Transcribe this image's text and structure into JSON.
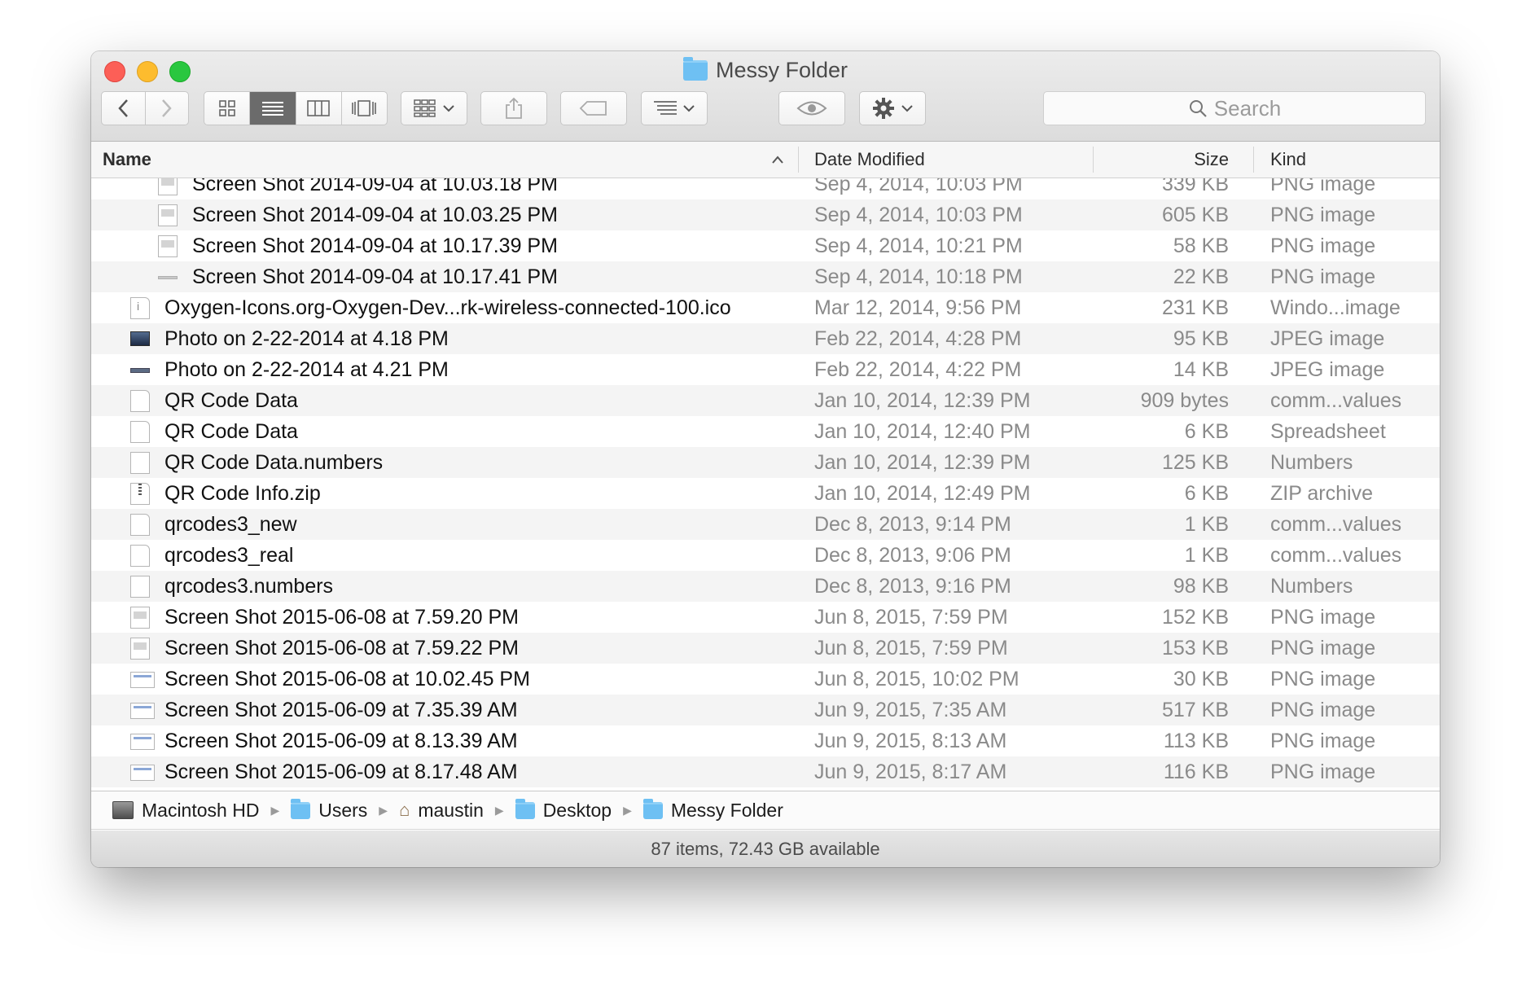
{
  "window": {
    "title": "Messy Folder"
  },
  "toolbar": {
    "back_icon": "chevron-left-icon",
    "forward_icon": "chevron-right-icon",
    "search_placeholder": "Search"
  },
  "columns": {
    "name": "Name",
    "date": "Date Modified",
    "size": "Size",
    "kind": "Kind"
  },
  "rows": [
    {
      "name": "Screen Shot 2014-09-04 at 10.03.18 PM",
      "date": "Sep 4, 2014, 10:03 PM",
      "size": "339 KB",
      "kind": "PNG image",
      "indent": true,
      "icon": "image-file-icon"
    },
    {
      "name": "Screen Shot 2014-09-04 at 10.03.25 PM",
      "date": "Sep 4, 2014, 10:03 PM",
      "size": "605 KB",
      "kind": "PNG image",
      "indent": true,
      "icon": "image-file-icon"
    },
    {
      "name": "Screen Shot 2014-09-04 at 10.17.39 PM",
      "date": "Sep 4, 2014, 10:21 PM",
      "size": "58 KB",
      "kind": "PNG image",
      "indent": true,
      "icon": "image-file-icon"
    },
    {
      "name": "Screen Shot 2014-09-04 at 10.17.41 PM",
      "date": "Sep 4, 2014, 10:18 PM",
      "size": "22 KB",
      "kind": "PNG image",
      "indent": true,
      "icon": "image-strip-icon"
    },
    {
      "name": "Oxygen-Icons.org-Oxygen-Dev...rk-wireless-connected-100.ico",
      "date": "Mar 12, 2014, 9:56 PM",
      "size": "231 KB",
      "kind": "Windo...image",
      "indent": false,
      "icon": "ico-file-icon"
    },
    {
      "name": "Photo on 2-22-2014 at 4.18 PM",
      "date": "Feb 22, 2014, 4:28 PM",
      "size": "95 KB",
      "kind": "JPEG image",
      "indent": false,
      "icon": "photo-icon"
    },
    {
      "name": "Photo on 2-22-2014 at 4.21 PM",
      "date": "Feb 22, 2014, 4:22 PM",
      "size": "14 KB",
      "kind": "JPEG image",
      "indent": false,
      "icon": "photo-strip-icon"
    },
    {
      "name": "QR Code Data",
      "date": "Jan 10, 2014, 12:39 PM",
      "size": "909 bytes",
      "kind": "comm...values",
      "indent": false,
      "icon": "document-icon"
    },
    {
      "name": "QR Code Data",
      "date": "Jan 10, 2014, 12:40 PM",
      "size": "6 KB",
      "kind": "Spreadsheet",
      "indent": false,
      "icon": "document-icon"
    },
    {
      "name": "QR Code Data.numbers",
      "date": "Jan 10, 2014, 12:39 PM",
      "size": "125 KB",
      "kind": "Numbers",
      "indent": false,
      "icon": "numbers-file-icon"
    },
    {
      "name": "QR Code Info.zip",
      "date": "Jan 10, 2014, 12:49 PM",
      "size": "6 KB",
      "kind": "ZIP archive",
      "indent": false,
      "icon": "zip-file-icon"
    },
    {
      "name": "qrcodes3_new",
      "date": "Dec 8, 2013, 9:14 PM",
      "size": "1 KB",
      "kind": "comm...values",
      "indent": false,
      "icon": "document-icon"
    },
    {
      "name": "qrcodes3_real",
      "date": "Dec 8, 2013, 9:06 PM",
      "size": "1 KB",
      "kind": "comm...values",
      "indent": false,
      "icon": "document-icon"
    },
    {
      "name": "qrcodes3.numbers",
      "date": "Dec 8, 2013, 9:16 PM",
      "size": "98 KB",
      "kind": "Numbers",
      "indent": false,
      "icon": "numbers-file-icon"
    },
    {
      "name": "Screen Shot 2015-06-08 at 7.59.20 PM",
      "date": "Jun 8, 2015, 7:59 PM",
      "size": "152 KB",
      "kind": "PNG image",
      "indent": false,
      "icon": "image-file-icon"
    },
    {
      "name": "Screen Shot 2015-06-08 at 7.59.22 PM",
      "date": "Jun 8, 2015, 7:59 PM",
      "size": "153 KB",
      "kind": "PNG image",
      "indent": false,
      "icon": "image-file-icon"
    },
    {
      "name": "Screen Shot 2015-06-08 at 10.02.45 PM",
      "date": "Jun 8, 2015, 10:02 PM",
      "size": "30 KB",
      "kind": "PNG image",
      "indent": false,
      "icon": "image-wide-icon"
    },
    {
      "name": "Screen Shot 2015-06-09 at 7.35.39 AM",
      "date": "Jun 9, 2015, 7:35 AM",
      "size": "517 KB",
      "kind": "PNG image",
      "indent": false,
      "icon": "image-wide-icon"
    },
    {
      "name": "Screen Shot 2015-06-09 at 8.13.39 AM",
      "date": "Jun 9, 2015, 8:13 AM",
      "size": "113 KB",
      "kind": "PNG image",
      "indent": false,
      "icon": "image-wide-icon"
    },
    {
      "name": "Screen Shot 2015-06-09 at 8.17.48 AM",
      "date": "Jun 9, 2015, 8:17 AM",
      "size": "116 KB",
      "kind": "PNG image",
      "indent": false,
      "icon": "image-wide-icon"
    }
  ],
  "pathbar": {
    "items": [
      {
        "label": "Macintosh HD",
        "icon": "hard-drive-icon"
      },
      {
        "label": "Users",
        "icon": "users-folder-icon"
      },
      {
        "label": "maustin",
        "icon": "home-icon"
      },
      {
        "label": "Desktop",
        "icon": "desktop-folder-icon"
      },
      {
        "label": "Messy Folder",
        "icon": "folder-icon"
      }
    ]
  },
  "status": {
    "text": "87 items, 72.43 GB available"
  }
}
